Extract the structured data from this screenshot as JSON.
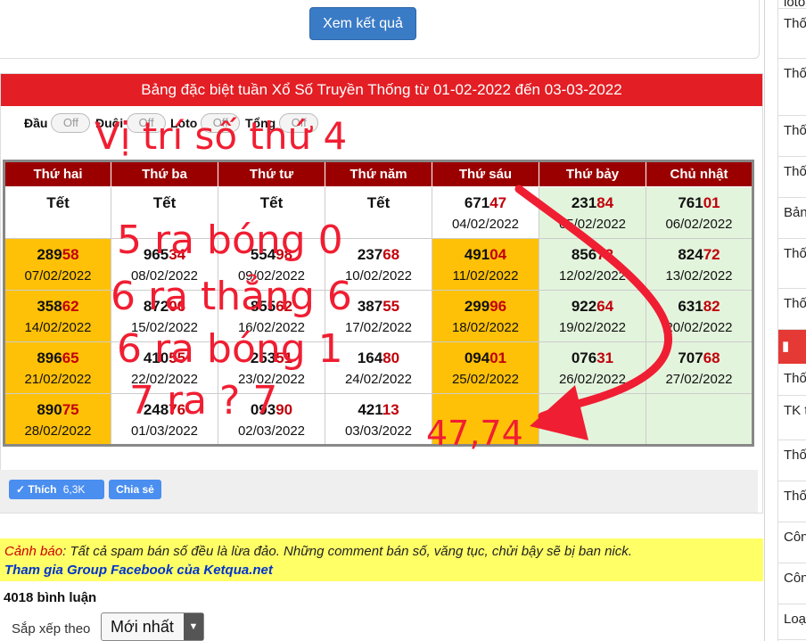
{
  "top_button": "Xem kết quả",
  "panel_title": "Bảng đặc biệt tuần Xổ Số Truyền Thống từ 01-02-2022 đến 03-03-2022",
  "toggles": [
    {
      "label": "Đầu",
      "state": "Off"
    },
    {
      "label": "Đuôi",
      "state": "Off"
    },
    {
      "label": "Loto",
      "state": "Off"
    },
    {
      "label": "Tổng",
      "state": "Off"
    }
  ],
  "weekdays": [
    "Thứ hai",
    "Thứ ba",
    "Thứ tư",
    "Thứ năm",
    "Thứ sáu",
    "Thứ bảy",
    "Chủ nhật"
  ],
  "rows": [
    [
      {
        "text": "Tết"
      },
      {
        "text": "Tết"
      },
      {
        "text": "Tết"
      },
      {
        "text": "Tết"
      },
      {
        "head": "671",
        "tail": "47",
        "date": "04/02/2022"
      },
      {
        "head": "231",
        "tail": "84",
        "date": "05/02/2022"
      },
      {
        "head": "761",
        "tail": "01",
        "date": "06/02/2022"
      }
    ],
    [
      {
        "head": "289",
        "tail": "58",
        "date": "07/02/2022"
      },
      {
        "head": "965",
        "tail": "34",
        "date": "08/02/2022"
      },
      {
        "head": "554",
        "tail": "98",
        "date": "09/02/2022"
      },
      {
        "head": "237",
        "tail": "68",
        "date": "10/02/2022"
      },
      {
        "head": "491",
        "tail": "04",
        "date": "11/02/2022"
      },
      {
        "head": "856",
        "tail": "72",
        "date": "12/02/2022"
      },
      {
        "head": "824",
        "tail": "72",
        "date": "13/02/2022"
      }
    ],
    [
      {
        "head": "358",
        "tail": "62",
        "date": "14/02/2022"
      },
      {
        "head": "872",
        "tail": "06",
        "date": "15/02/2022"
      },
      {
        "head": "855",
        "tail": "62",
        "date": "16/02/2022"
      },
      {
        "head": "387",
        "tail": "55",
        "date": "17/02/2022"
      },
      {
        "head": "299",
        "tail": "96",
        "date": "18/02/2022"
      },
      {
        "head": "922",
        "tail": "64",
        "date": "19/02/2022"
      },
      {
        "head": "631",
        "tail": "82",
        "date": "20/02/2022"
      }
    ],
    [
      {
        "head": "896",
        "tail": "65",
        "date": "21/02/2022"
      },
      {
        "head": "410",
        "tail": "55",
        "date": "22/02/2022"
      },
      {
        "head": "253",
        "tail": "51",
        "date": "23/02/2022"
      },
      {
        "head": "164",
        "tail": "80",
        "date": "24/02/2022"
      },
      {
        "head": "094",
        "tail": "01",
        "date": "25/02/2022"
      },
      {
        "head": "076",
        "tail": "31",
        "date": "26/02/2022"
      },
      {
        "head": "707",
        "tail": "68",
        "date": "27/02/2022"
      }
    ],
    [
      {
        "head": "890",
        "tail": "75",
        "date": "28/02/2022"
      },
      {
        "head": "248",
        "tail": "76",
        "date": "01/03/2022"
      },
      {
        "head": "093",
        "tail": "90",
        "date": "02/03/2022"
      },
      {
        "head": "421",
        "tail": "13",
        "date": "03/03/2022"
      },
      {
        "empty": true
      },
      {
        "empty": true
      },
      {
        "empty": true
      }
    ]
  ],
  "social": {
    "like_label": "Thích",
    "like_count": "6,3K",
    "share_label": "Chia sẻ"
  },
  "warning": {
    "label": "Cảnh báo",
    "text": ": Tất cả spam bán số đều là lừa đảo. Những comment bán số, văng tục, chửi bậy sẽ bị ban nick.",
    "link": "Tham gia Group Facebook của Ketqua.net"
  },
  "comment_count": "4018 bình luận",
  "sort": {
    "label": "Sắp xếp theo",
    "value": "Mới nhất"
  },
  "right_sidebar": [
    "loto",
    "Thố",
    "Thố loto",
    "Thố",
    "Thố",
    "Bản",
    "Thố theo",
    "Thố",
    "Thố",
    "TK t",
    "Thố",
    "Thố",
    "Côn",
    "Côn VIP",
    "Loạ"
  ],
  "annotations": {
    "title": "Vị trí số thứ 4",
    "line1": "5 ra bóng 0",
    "line2": "6 ra thẳng 6",
    "line3": "6 ra bóng 1",
    "line4": "7 ra  ?  7",
    "result": "47,74",
    "color": "#f01e32"
  }
}
